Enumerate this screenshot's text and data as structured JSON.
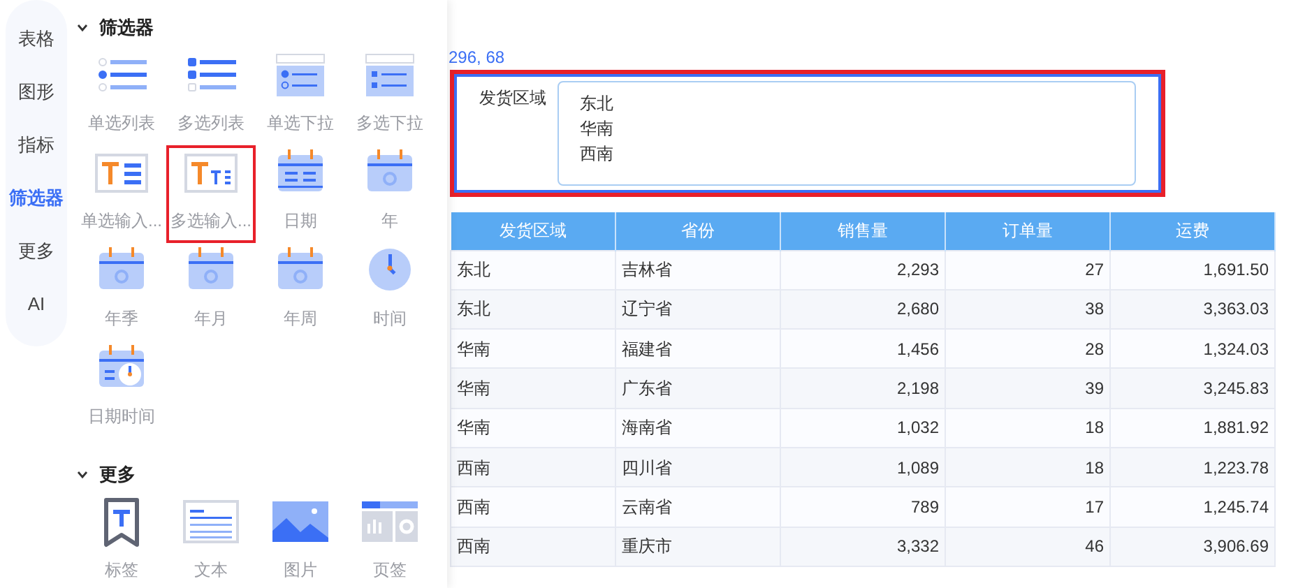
{
  "rail": [
    {
      "label": "表格",
      "selected": false
    },
    {
      "label": "图形",
      "selected": false
    },
    {
      "label": "指标",
      "selected": false
    },
    {
      "label": "筛选器",
      "selected": true
    },
    {
      "label": "更多",
      "selected": false
    },
    {
      "label": "AI",
      "selected": false
    }
  ],
  "sections": [
    {
      "title": "筛选器",
      "expanded": true,
      "items": [
        {
          "label": "单选列表",
          "kind": "radio-list",
          "selected": false
        },
        {
          "label": "多选列表",
          "kind": "check-list",
          "selected": false
        },
        {
          "label": "单选下拉",
          "kind": "radio-dropdown",
          "selected": false
        },
        {
          "label": "多选下拉",
          "kind": "check-dropdown",
          "selected": false
        },
        {
          "label": "单选输入...",
          "kind": "text-input",
          "selected": false
        },
        {
          "label": "多选输入...",
          "kind": "multi-text-input",
          "selected": true
        },
        {
          "label": "日期",
          "kind": "date",
          "selected": false
        },
        {
          "label": "年",
          "kind": "year",
          "selected": false
        },
        {
          "label": "年季",
          "kind": "quarter",
          "selected": false
        },
        {
          "label": "年月",
          "kind": "month",
          "selected": false
        },
        {
          "label": "年周",
          "kind": "week",
          "selected": false
        },
        {
          "label": "时间",
          "kind": "time",
          "selected": false
        },
        {
          "label": "日期时间",
          "kind": "datetime",
          "selected": false
        }
      ]
    },
    {
      "title": "更多",
      "expanded": true,
      "items": [
        {
          "label": "标签",
          "kind": "label",
          "selected": false
        },
        {
          "label": "文本",
          "kind": "text",
          "selected": false
        },
        {
          "label": "图片",
          "kind": "image",
          "selected": false
        },
        {
          "label": "页签",
          "kind": "tab",
          "selected": false
        }
      ]
    }
  ],
  "canvas": {
    "position": "296, 68",
    "filter": {
      "label": "发货区域",
      "values": [
        "东北",
        "华南",
        "西南"
      ],
      "selected": true
    }
  },
  "table": {
    "columns": [
      "发货区域",
      "省份",
      "销售量",
      "订单量",
      "运费"
    ],
    "rows": [
      [
        "东北",
        "吉林省",
        "2,293",
        "27",
        "1,691.50"
      ],
      [
        "东北",
        "辽宁省",
        "2,680",
        "38",
        "3,363.03"
      ],
      [
        "华南",
        "福建省",
        "1,456",
        "28",
        "1,324.03"
      ],
      [
        "华南",
        "广东省",
        "2,198",
        "39",
        "3,245.83"
      ],
      [
        "华南",
        "海南省",
        "1,032",
        "18",
        "1,881.92"
      ],
      [
        "西南",
        "四川省",
        "1,089",
        "18",
        "1,223.78"
      ],
      [
        "西南",
        "云南省",
        "789",
        "17",
        "1,245.74"
      ],
      [
        "西南",
        "重庆市",
        "3,332",
        "46",
        "3,906.69"
      ]
    ]
  }
}
